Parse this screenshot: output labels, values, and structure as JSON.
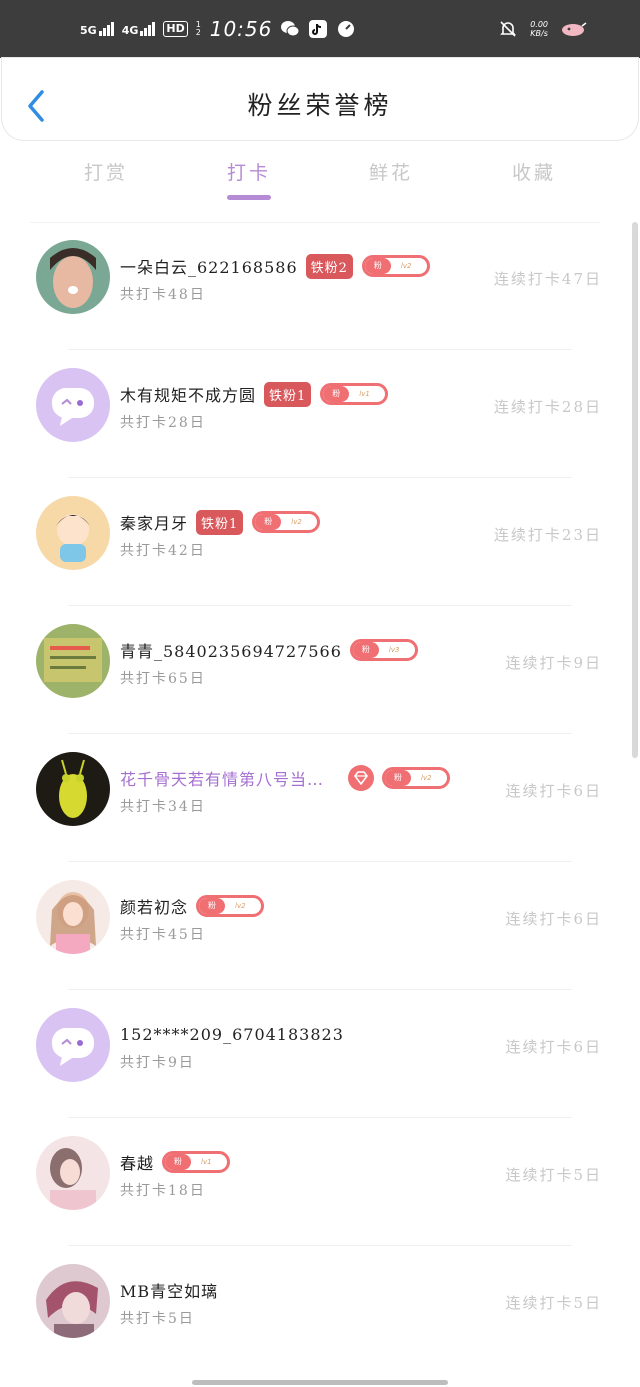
{
  "status_bar": {
    "net1": "5G",
    "net2": "4G",
    "hd": "HD",
    "hd_sub": "1 2",
    "time": "10:56",
    "speed_value": "0.00",
    "speed_unit": "KB/s"
  },
  "header": {
    "title": "粉丝荣誉榜",
    "back_icon": "chevron-left-icon"
  },
  "tabs": [
    {
      "label": "打赏",
      "active": false
    },
    {
      "label": "打卡",
      "active": true
    },
    {
      "label": "鲜花",
      "active": false
    },
    {
      "label": "收藏",
      "active": false
    }
  ],
  "colors": {
    "accent": "#b58bd6",
    "badge_red": "#d9585c",
    "fan_pill": "#ef6f73",
    "muted_text": "#9a9a9a",
    "streak_text": "#c8c8c8"
  },
  "fan_badge": {
    "head": "粉",
    "level1": "lv1",
    "level2": "lv2",
    "level3": "lv3"
  },
  "rows": [
    {
      "name": "一朵白云_622168586",
      "badge": "铁粉2",
      "fan_level": "lv2",
      "total": "共打卡48日",
      "streak": "连续打卡47日"
    },
    {
      "name": "木有规矩不成方圆",
      "badge": "铁粉1",
      "fan_level": "lv1",
      "total": "共打卡28日",
      "streak": "连续打卡28日"
    },
    {
      "name": "秦家月牙",
      "badge": "铁粉1",
      "fan_level": "lv2",
      "total": "共打卡42日",
      "streak": "连续打卡23日"
    },
    {
      "name": "青青_5840235694727566",
      "badge": "",
      "fan_level": "lv3",
      "total": "共打卡65日",
      "streak": "连续打卡9日"
    },
    {
      "name": "花千骨天若有情第八号当…",
      "badge": "",
      "fan_level": "lv2",
      "total": "共打卡34日",
      "streak": "连续打卡6日"
    },
    {
      "name": "颜若初念",
      "badge": "",
      "fan_level": "lv2",
      "total": "共打卡45日",
      "streak": "连续打卡6日"
    },
    {
      "name": "152****209_6704183823",
      "badge": "",
      "fan_level": "",
      "total": "共打卡9日",
      "streak": "连续打卡6日"
    },
    {
      "name": "春越",
      "badge": "",
      "fan_level": "lv1",
      "total": "共打卡18日",
      "streak": "连续打卡5日"
    },
    {
      "name": "MB青空如璃",
      "badge": "",
      "fan_level": "",
      "total": "共打卡5日",
      "streak": "连续打卡5日"
    }
  ]
}
